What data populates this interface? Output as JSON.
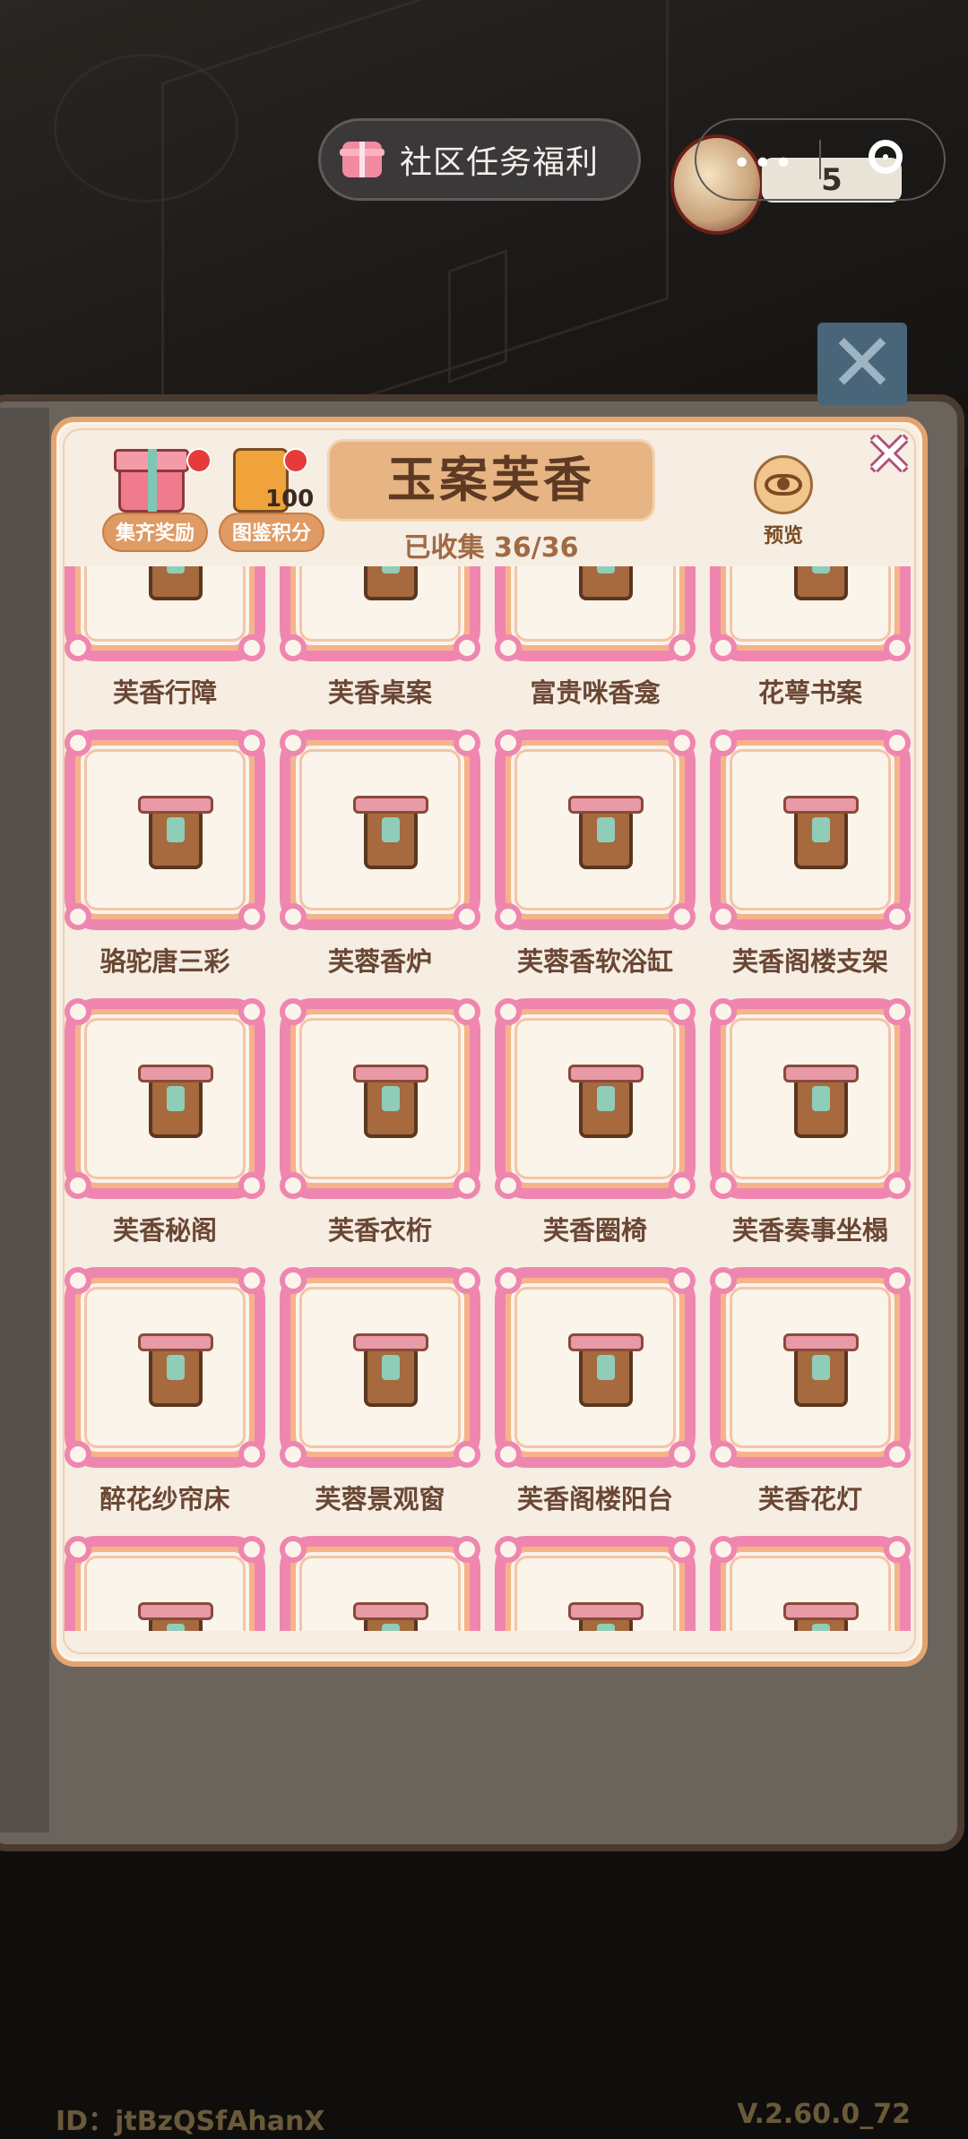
{
  "top_bar": {
    "community_label": "社区任务福利",
    "counter": "5",
    "more_glyph": "•••"
  },
  "panel": {
    "title": "玉案芙香",
    "collected": "已收集 36/36",
    "buttons": {
      "set_reward": "集齐奖励",
      "codex_points": "图鉴积分",
      "codex_points_badge": "100",
      "preview": "预览"
    },
    "close_glyph": "✕"
  },
  "items": [
    {
      "label": "芙香行障"
    },
    {
      "label": "芙香桌案"
    },
    {
      "label": "富贵咪香龛"
    },
    {
      "label": "花萼书案"
    },
    {
      "label": "骆驼唐三彩"
    },
    {
      "label": "芙蓉香炉"
    },
    {
      "label": "芙蓉香软浴缸"
    },
    {
      "label": "芙香阁楼支架"
    },
    {
      "label": "芙香秘阁"
    },
    {
      "label": "芙香衣桁"
    },
    {
      "label": "芙香圈椅"
    },
    {
      "label": "芙香奏事坐榻"
    },
    {
      "label": "醉花纱帘床"
    },
    {
      "label": "芙蓉景观窗"
    },
    {
      "label": "芙香阁楼阳台"
    },
    {
      "label": "芙香花灯"
    },
    {
      "label": ""
    },
    {
      "label": ""
    },
    {
      "label": ""
    },
    {
      "label": ""
    }
  ],
  "footer": {
    "id": "ID：jtBzQSfAhanX",
    "version": "V.2.60.0_72"
  },
  "colors": {
    "frame_pink": "#ef86b0",
    "panel_bg": "#f6ede3",
    "title_plate": "#e7b583"
  }
}
